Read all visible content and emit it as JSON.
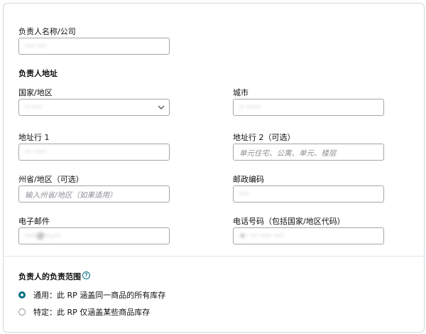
{
  "owner": {
    "name_label": "负责人名称/公司",
    "name_value": "···· ····"
  },
  "address": {
    "section_title": "负责人地址",
    "country_label": "国家/地区",
    "country_value": "·· ····",
    "city_label": "城市",
    "city_value": "·· ······",
    "line1_label": "地址行 1",
    "line1_value": "··· ·····",
    "line2_label": "地址行 2（可选）",
    "line2_placeholder": "单元住宅、公寓、单元、楼层",
    "state_label": "州省/地区（可选）",
    "state_placeholder": "输入州省/地区（如果适用）",
    "postal_label": "邮政编码",
    "postal_value": "····",
    "email_label": "电子邮件",
    "email_value": "·····@···.···",
    "phone_label": "电话号码（包括国家/地区代码）",
    "phone_value": "+· ··· ····· ····"
  },
  "scope": {
    "title": "负责人的负责范围",
    "help_icon": "?",
    "options": [
      {
        "label": "通用：此 RP 涵盖同一商品的所有库存",
        "selected": true
      },
      {
        "label": "特定：此 RP 仅涵盖某些商品库存",
        "selected": false
      }
    ]
  },
  "colors": {
    "accent": "#007185",
    "border": "#a6a6a6"
  }
}
